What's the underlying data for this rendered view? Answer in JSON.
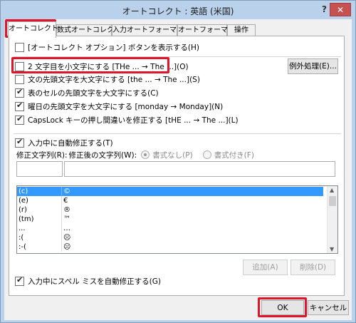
{
  "window": {
    "title": "オートコレクト : 英語 (米国)",
    "help_glyph": "?",
    "close_glyph": "✕"
  },
  "tabs": [
    {
      "label": "オートコレクト",
      "active": true
    },
    {
      "label": "数式オートコレクト",
      "active": false
    },
    {
      "label": "入力オートフォーマット",
      "active": false
    },
    {
      "label": "オートフォーマット",
      "active": false
    },
    {
      "label": "操作",
      "active": false
    }
  ],
  "options": {
    "show_buttons": "[オートコレクト オプション] ボタンを表示する(H)",
    "two_initial_caps": "2 文字目を小文字にする [THe ... → The ...](O)",
    "capitalize_sentences": "文の先頭文字を大文字にする [the ... → The ...](S)",
    "capitalize_table_cells": "表のセルの先頭文字を大文字にする(C)",
    "capitalize_days": "曜日の先頭文字を大文字にする [monday → Monday](N)",
    "caps_lock": "CapsLock キーの押し間違いを修正する [tHE ... → The ...](L)",
    "replace_as_you_type": "入力中に自動修正する(T)",
    "auto_spell": "入力中にスペル ミスを自動修正する(G)"
  },
  "checked": {
    "show_buttons": false,
    "two_initial_caps": false,
    "capitalize_sentences": false,
    "capitalize_table_cells": true,
    "capitalize_days": true,
    "caps_lock": true,
    "replace_as_you_type": true,
    "auto_spell": true
  },
  "exceptions_button": "例外処理(E)...",
  "replace_label": "修正文字列(R):",
  "with_label": "修正後の文字列(W):",
  "radio_plain": "書式なし(P)",
  "radio_formatted": "書式付き(F)",
  "replace_value": "",
  "with_value": "",
  "entries": [
    {
      "from": "(c)",
      "to": "©"
    },
    {
      "from": "(e)",
      "to": "€"
    },
    {
      "from": "(r)",
      "to": "®"
    },
    {
      "from": "(tm)",
      "to": "™"
    },
    {
      "from": "...",
      "to": "…"
    },
    {
      "from": ":(",
      "to": "☹"
    },
    {
      "from": ":-(",
      "to": "☹"
    }
  ],
  "add_button": "追加(A)",
  "delete_button": "削除(D)",
  "ok_button": "OK",
  "cancel_button": "キャンセル",
  "colors": {
    "highlight": "#e0152a",
    "selection": "#3399ff",
    "title_bar": "#b9d1ea",
    "close_button": "#c75050"
  }
}
